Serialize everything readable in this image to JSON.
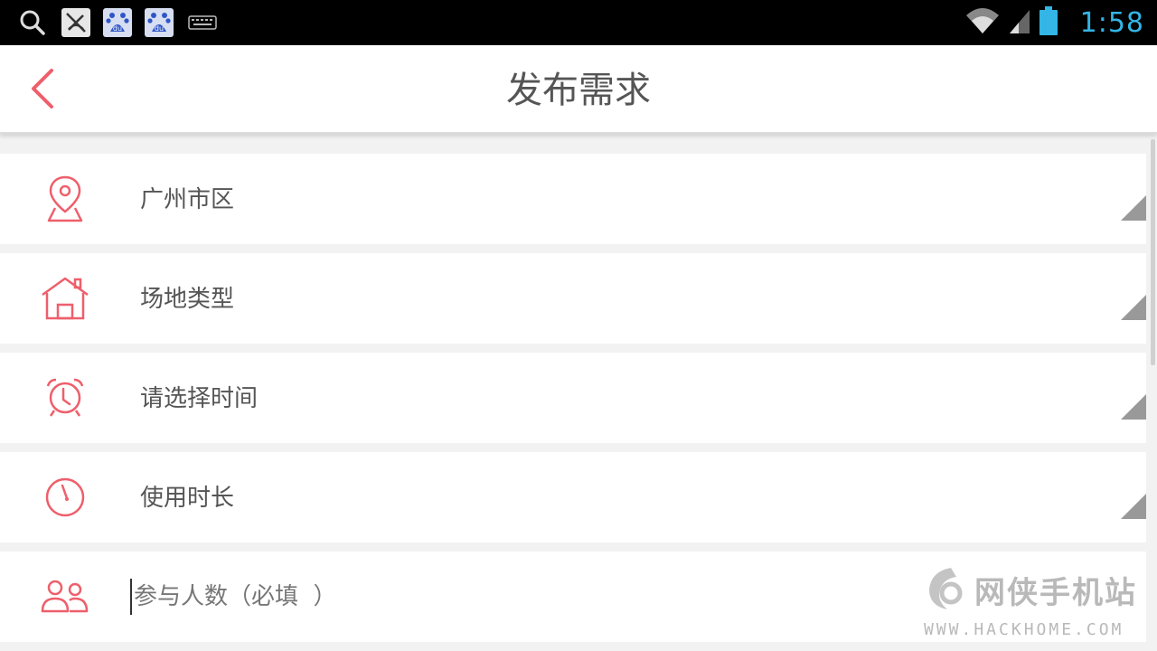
{
  "status_bar": {
    "time": "1:58",
    "left_icons": [
      "search-icon",
      "app-icon",
      "baidu-icon",
      "baidu-icon",
      "keyboard-icon"
    ],
    "right_icons": [
      "wifi-icon",
      "signal-icon",
      "battery-icon"
    ],
    "baidu_text": "du"
  },
  "header": {
    "title": "发布需求",
    "back_icon": "back-arrow-icon"
  },
  "form": {
    "rows": [
      {
        "icon": "location-pin-icon",
        "label": "广州市区"
      },
      {
        "icon": "house-icon",
        "label": "场地类型"
      },
      {
        "icon": "alarm-clock-icon",
        "label": "请选择时间"
      },
      {
        "icon": "timer-icon",
        "label": "使用时长"
      }
    ],
    "participants": {
      "icon": "people-icon",
      "placeholder": "参与人数（必填  ）"
    }
  },
  "watermark": {
    "name": "网侠手机站",
    "url": "WWW.HACKHOME.COM"
  },
  "colors": {
    "accent": "#ee5f6b",
    "title_text": "#555555",
    "clock": "#33b5e5"
  }
}
